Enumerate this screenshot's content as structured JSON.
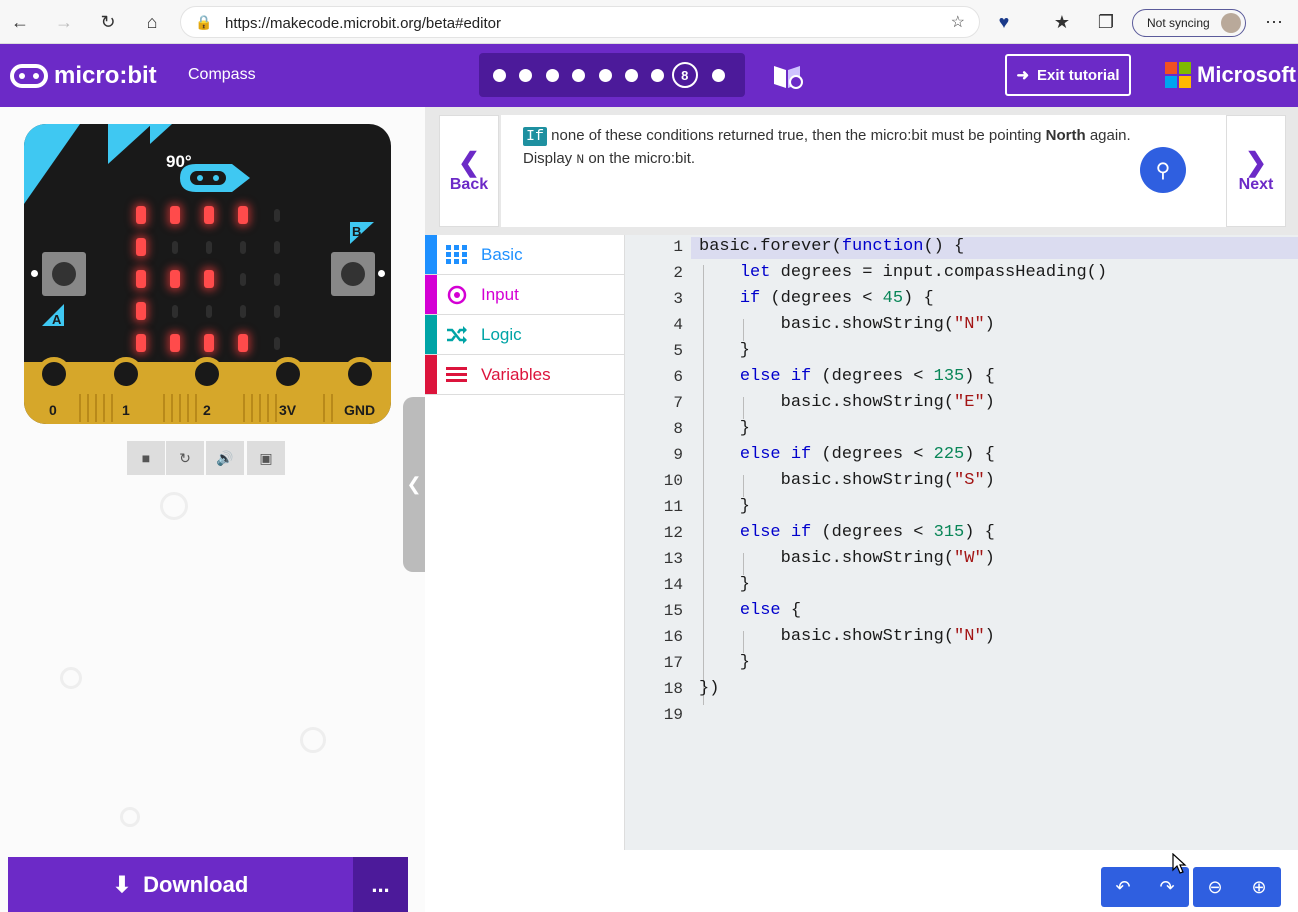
{
  "browser": {
    "url": "https://makecode.microbit.org/beta#editor",
    "sync_label": "Not syncing"
  },
  "header": {
    "brand": "micro:bit",
    "project_name": "Compass",
    "current_step": "8",
    "exit_label": "Exit tutorial",
    "ms_label": "Microsoft",
    "ms_colors": [
      "#f25022",
      "#7fba00",
      "#00a4ef",
      "#ffb900"
    ],
    "accent": "#6c2ac7"
  },
  "simulator": {
    "heading": "90°",
    "button_a": "A",
    "button_b": "B",
    "pins": [
      "0",
      "1",
      "2",
      "3V",
      "GND"
    ]
  },
  "hint": {
    "keyword": "If",
    "text_1": " none of these conditions returned true, then the micro:bit must be pointing ",
    "bold": "North",
    "text_2": " again. Display ",
    "code": "N",
    "text_3": " on the micro:bit.",
    "back_label": "Back",
    "next_label": "Next"
  },
  "toolbox": [
    {
      "label": "Basic",
      "color": "#1e90ff"
    },
    {
      "label": "Input",
      "color": "#d400d4"
    },
    {
      "label": "Logic",
      "color": "#00a4a6"
    },
    {
      "label": "Variables",
      "color": "#dc143c"
    }
  ],
  "editor": {
    "line_numbers": [
      "1",
      "2",
      "3",
      "4",
      "5",
      "6",
      "7",
      "8",
      "9",
      "10",
      "11",
      "12",
      "13",
      "14",
      "15",
      "16",
      "17",
      "18",
      "19"
    ]
  },
  "footer": {
    "download_label": "Download",
    "more_label": "..."
  }
}
